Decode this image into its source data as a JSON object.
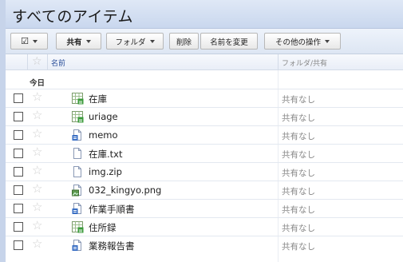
{
  "header": {
    "title": "すべてのアイテム"
  },
  "toolbar": {
    "share_label": "共有",
    "folder_label": "フォルダ",
    "delete_label": "削除",
    "rename_label": "名前を変更",
    "more_actions_label": "その他の操作"
  },
  "columns": {
    "name": "名前",
    "share": "フォルダ/共有"
  },
  "group": {
    "label": "今日"
  },
  "files": [
    {
      "name": "在庫",
      "type": "spreadsheet",
      "share": "共有なし"
    },
    {
      "name": "uriage",
      "type": "spreadsheet",
      "share": "共有なし"
    },
    {
      "name": "memo",
      "type": "document",
      "share": "共有なし"
    },
    {
      "name": "在庫.txt",
      "type": "file",
      "share": "共有なし"
    },
    {
      "name": "img.zip",
      "type": "file",
      "share": "共有なし"
    },
    {
      "name": "032_kingyo.png",
      "type": "image",
      "share": "共有なし"
    },
    {
      "name": "作業手順書",
      "type": "document",
      "share": "共有なし"
    },
    {
      "name": "住所録",
      "type": "spreadsheet",
      "share": "共有なし"
    },
    {
      "name": "業務報告書",
      "type": "document",
      "share": "共有なし"
    }
  ],
  "colors": {
    "header_bg": "#c9d7ee",
    "link_blue": "#2a4f9a",
    "spreadsheet_green": "#3a9a3a",
    "document_blue": "#3a6fc4"
  }
}
